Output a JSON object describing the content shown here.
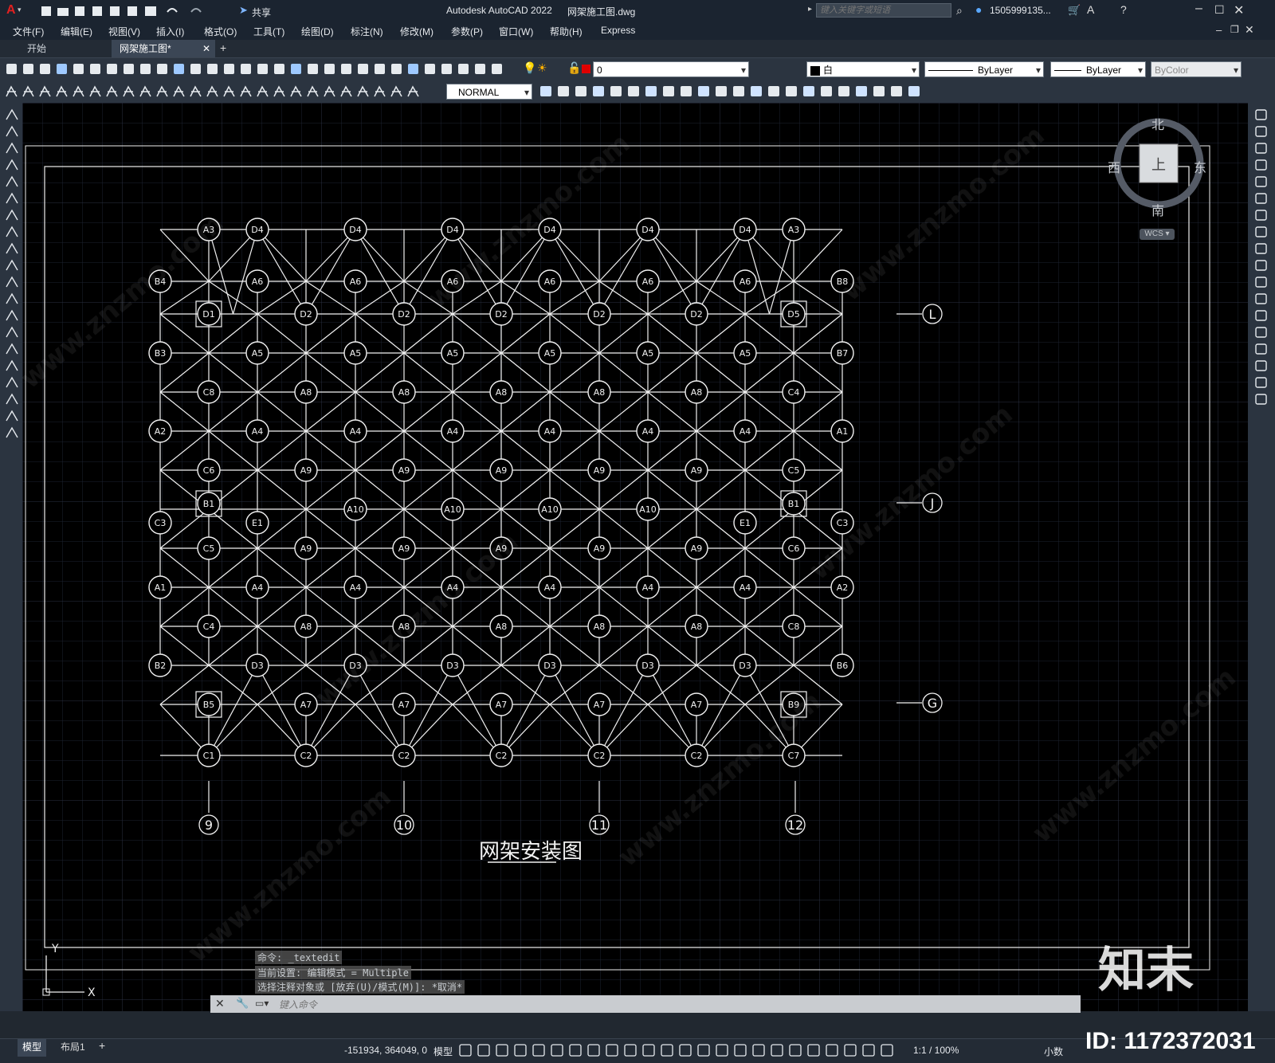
{
  "app": {
    "title": "Autodesk AutoCAD 2022",
    "file": "网架施工图.dwg",
    "share": "共享",
    "search_placeholder": "键入关键字或短语",
    "user": "1505999135...",
    "logo": "A"
  },
  "menu": [
    "文件(F)",
    "编辑(E)",
    "视图(V)",
    "插入(I)",
    "格式(O)",
    "工具(T)",
    "绘图(D)",
    "标注(N)",
    "修改(M)",
    "参数(P)",
    "窗口(W)",
    "帮助(H)",
    "Express"
  ],
  "tabs": [
    {
      "label": "开始"
    },
    {
      "label": "网架施工图*"
    }
  ],
  "ribbon": {
    "layer": "0",
    "color": "白",
    "linetype": "ByLayer",
    "lineweight": "ByLayer",
    "plotstyle": "ByColor",
    "dimstyle": "NORMAL"
  },
  "viewcube": {
    "north": "北",
    "south": "南",
    "east": "东",
    "west": "西",
    "top": "上",
    "wcs": "WCS"
  },
  "drawing": {
    "title": "网架安装图",
    "axis_bottom": [
      "9",
      "10",
      "11",
      "12"
    ],
    "axis_right": [
      "L",
      "J",
      "G"
    ],
    "ucs_x": "X",
    "ucs_y": "Y"
  },
  "command": {
    "history": [
      "命令: _textedit",
      "当前设置: 编辑模式 = Multiple",
      "选择注释对象或 [放弃(U)/模式(M)]: *取消*"
    ],
    "placeholder": "键入命令"
  },
  "status": {
    "layouts": [
      "模型",
      "布局1"
    ],
    "coords": "-151934, 364049, 0",
    "model": "模型",
    "scale": "1:1 / 100%",
    "units": "小数"
  },
  "watermark": {
    "brand": "知末",
    "id": "ID: 1172372031",
    "text": "www.znzmo.com"
  }
}
